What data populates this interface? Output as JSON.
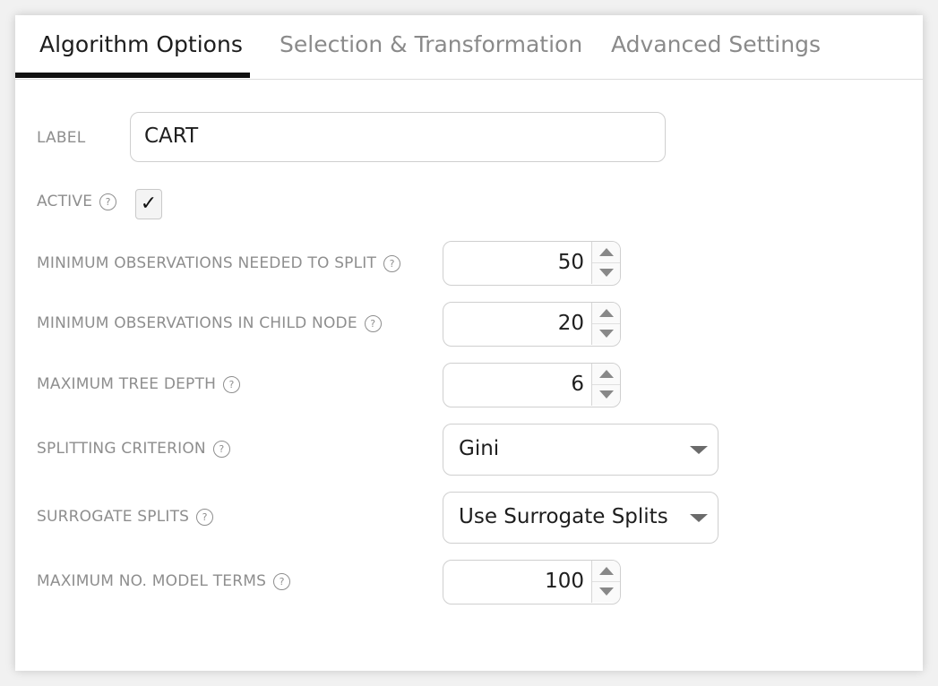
{
  "tabs": [
    {
      "label": "Algorithm Options",
      "active": true
    },
    {
      "label": "Selection & Transformation",
      "active": false
    },
    {
      "label": "Advanced Settings",
      "active": false
    }
  ],
  "help_glyph": "?",
  "form": {
    "label": {
      "label": "LABEL",
      "value": "CART"
    },
    "active": {
      "label": "ACTIVE",
      "checked": true,
      "check_glyph": "✓"
    },
    "min_obs_split": {
      "label": "MINIMUM OBSERVATIONS NEEDED TO SPLIT",
      "value": "50"
    },
    "min_obs_child": {
      "label": "MINIMUM OBSERVATIONS IN CHILD NODE",
      "value": "20"
    },
    "max_depth": {
      "label": "MAXIMUM TREE DEPTH",
      "value": "6"
    },
    "splitting_criterion": {
      "label": "SPLITTING CRITERION",
      "value": "Gini"
    },
    "surrogate_splits": {
      "label": "SURROGATE SPLITS",
      "value": "Use Surrogate Splits"
    },
    "max_model_terms": {
      "label": "MAXIMUM NO. MODEL TERMS",
      "value": "100"
    }
  },
  "colors": {
    "active_tab": "#1d1d1d",
    "inactive_tab": "#8a8a8a",
    "label_text": "#8e8e8e",
    "border": "#cfcfcf"
  }
}
